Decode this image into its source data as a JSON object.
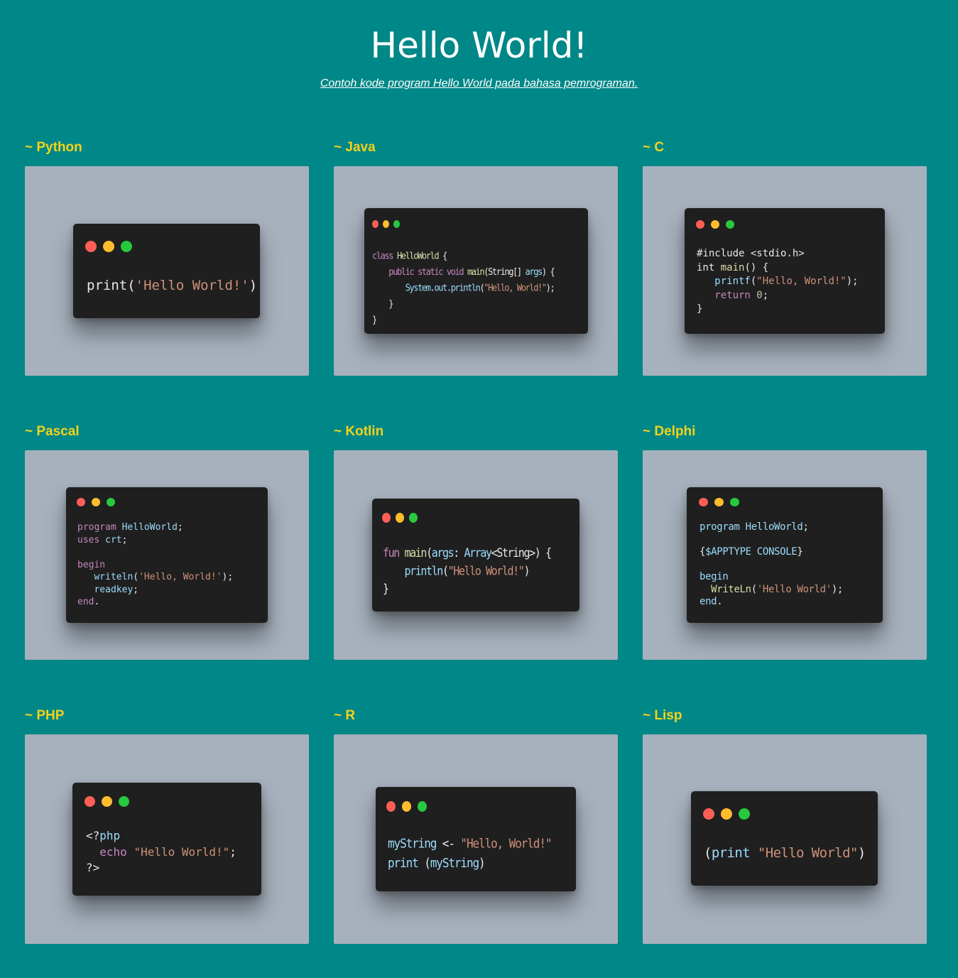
{
  "page": {
    "title": "Hello World!",
    "subtitle": "Contoh kode program Hello World pada bahasa pemrograman."
  },
  "colors": {
    "background": "#008787",
    "label": "#f2d31b",
    "panel": "#a7b1bd",
    "code_window": "#1f1f1f",
    "dot_red": "#ff5f56",
    "dot_yellow": "#ffbd2e",
    "dot_green": "#27c93f"
  },
  "cards": {
    "python": {
      "label": "~ Python",
      "code": {
        "l1a": "print(",
        "l1b": "'Hello World!'",
        "l1c": ")"
      }
    },
    "java": {
      "label": "~ Java",
      "code": {
        "l1a": "class ",
        "l1b": "HelloWorld",
        "l1c": " {",
        "l2a": "    public static void ",
        "l2b": "main",
        "l2c": "(",
        "l2d": "String",
        "l2e": "[] ",
        "l2f": "args",
        "l2g": ") {",
        "l3a": "        System",
        "l3b": ".",
        "l3c": "out",
        "l3d": ".",
        "l3e": "println",
        "l3f": "(",
        "l3g": "\"Hello, World!\"",
        "l3h": ");",
        "l4": "    }",
        "l5": "}"
      }
    },
    "c": {
      "label": "~ C",
      "code": {
        "l1": "#include <stdio.h>",
        "l2a": "int ",
        "l2b": "main",
        "l2c": "() {",
        "l3a": "   printf",
        "l3b": "(",
        "l3c": "\"Hello, World!\"",
        "l3d": ");",
        "l4a": "   return ",
        "l4b": "0",
        "l4c": ";",
        "l5": "}"
      }
    },
    "pascal": {
      "label": "~ Pascal",
      "code": {
        "l1a": "program ",
        "l1b": "HelloWorld",
        "l1c": ";",
        "l2a": "uses ",
        "l2b": "crt",
        "l2c": ";",
        "l3": "",
        "l4": "begin",
        "l5a": "   writeln",
        "l5b": "(",
        "l5c": "'Hello, World!'",
        "l5d": ");",
        "l6a": "   readkey",
        "l6b": ";",
        "l7a": "end",
        "l7b": "."
      }
    },
    "kotlin": {
      "label": "~ Kotlin",
      "code": {
        "l1a": "fun ",
        "l1b": "main",
        "l1c": "(",
        "l1d": "args",
        "l1e": ": ",
        "l1f": "Array",
        "l1g": "<String>) {",
        "l2a": "    println",
        "l2b": "(",
        "l2c": "\"Hello World!\"",
        "l2d": ")",
        "l3": "}"
      }
    },
    "delphi": {
      "label": "~ Delphi",
      "code": {
        "l1a": "program ",
        "l1b": "HelloWorld",
        "l1c": ";",
        "l2": "",
        "l3a": "{",
        "l3b": "$APPTYPE CONSOLE",
        "l3c": "}",
        "l4": "",
        "l5": "begin",
        "l6a": "  WriteLn",
        "l6b": "(",
        "l6c": "'Hello World'",
        "l6d": ");",
        "l7a": "end",
        "l7b": "."
      }
    },
    "php": {
      "label": "~ PHP",
      "code": {
        "l1a": "<?",
        "l1b": "php",
        "l2a": "  echo ",
        "l2b": "\"Hello World!\"",
        "l2c": ";",
        "l3": "?>"
      }
    },
    "r": {
      "label": "~ R",
      "code": {
        "l1a": "myString",
        "l1b": " <- ",
        "l1c": "\"Hello, World!\"",
        "l2a": "print",
        "l2b": " (",
        "l2c": "myString",
        "l2d": ")"
      }
    },
    "lisp": {
      "label": "~ Lisp",
      "code": {
        "l1a": "(",
        "l1b": "print ",
        "l1c": "\"Hello World\"",
        "l1d": ")"
      }
    }
  }
}
